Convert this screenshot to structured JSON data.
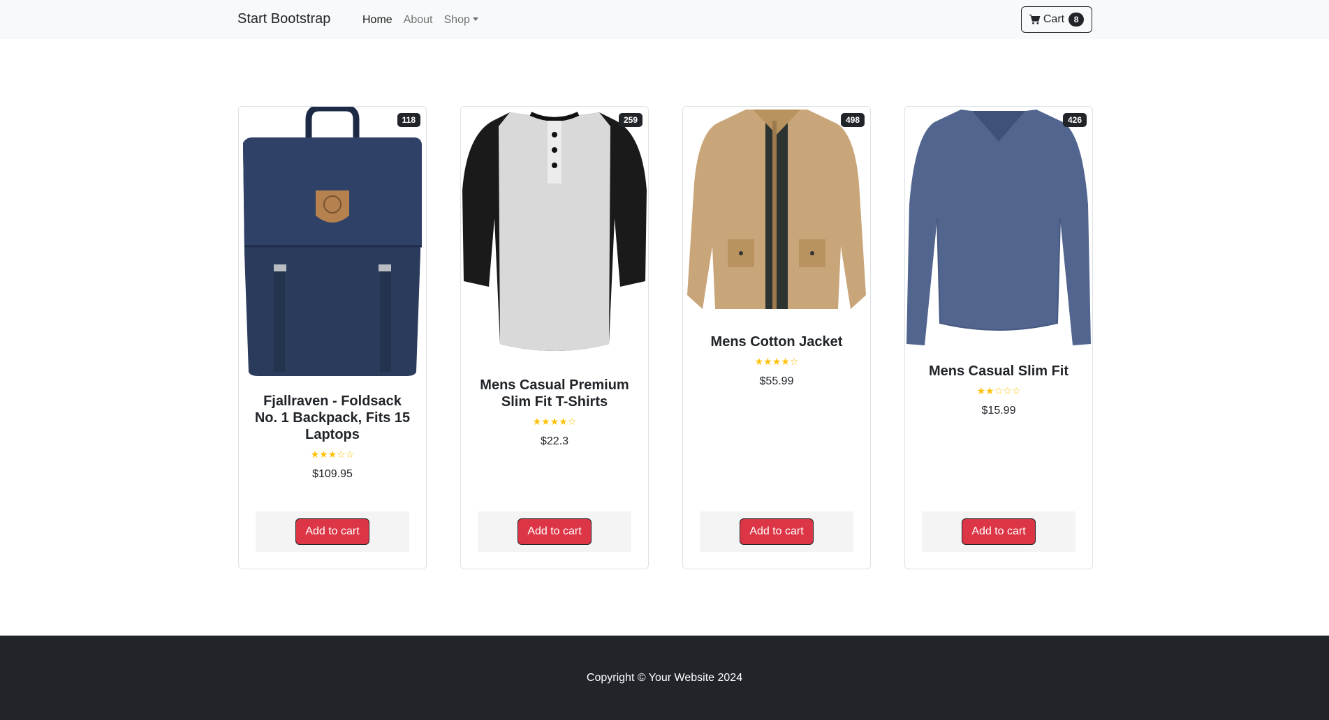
{
  "navbar": {
    "brand": "Start Bootstrap",
    "links": [
      {
        "label": "Home",
        "active": true
      },
      {
        "label": "About",
        "active": false
      },
      {
        "label": "Shop",
        "active": false
      }
    ],
    "cart": {
      "label": "Cart",
      "count": "8",
      "icon": "cart-icon"
    }
  },
  "products": [
    {
      "badge": "118",
      "title": "Fjallraven - Foldsack No. 1 Backpack, Fits 15 Laptops",
      "rating": 3,
      "stars": "★★★☆☆",
      "price": "$109.95",
      "button": "Add to cart",
      "image": "backpack"
    },
    {
      "badge": "259",
      "title": "Mens Casual Premium Slim Fit T-Shirts",
      "rating": 4,
      "stars": "★★★★☆",
      "price": "$22.3",
      "button": "Add to cart",
      "image": "raglan-tshirt"
    },
    {
      "badge": "498",
      "title": "Mens Cotton Jacket",
      "rating": 4,
      "stars": "★★★★☆",
      "price": "$55.99",
      "button": "Add to cart",
      "image": "cotton-jacket"
    },
    {
      "badge": "426",
      "title": "Mens Casual Slim Fit",
      "rating": 2,
      "stars": "★★☆☆☆",
      "price": "$15.99",
      "button": "Add to cart",
      "image": "longsleeve-shirt"
    }
  ],
  "footer": {
    "text": "Copyright © Your Website 2024"
  },
  "colors": {
    "navbar_bg": "#f8f9fa",
    "button_danger": "#dc3545",
    "dark": "#212529",
    "star": "#ffc107"
  }
}
